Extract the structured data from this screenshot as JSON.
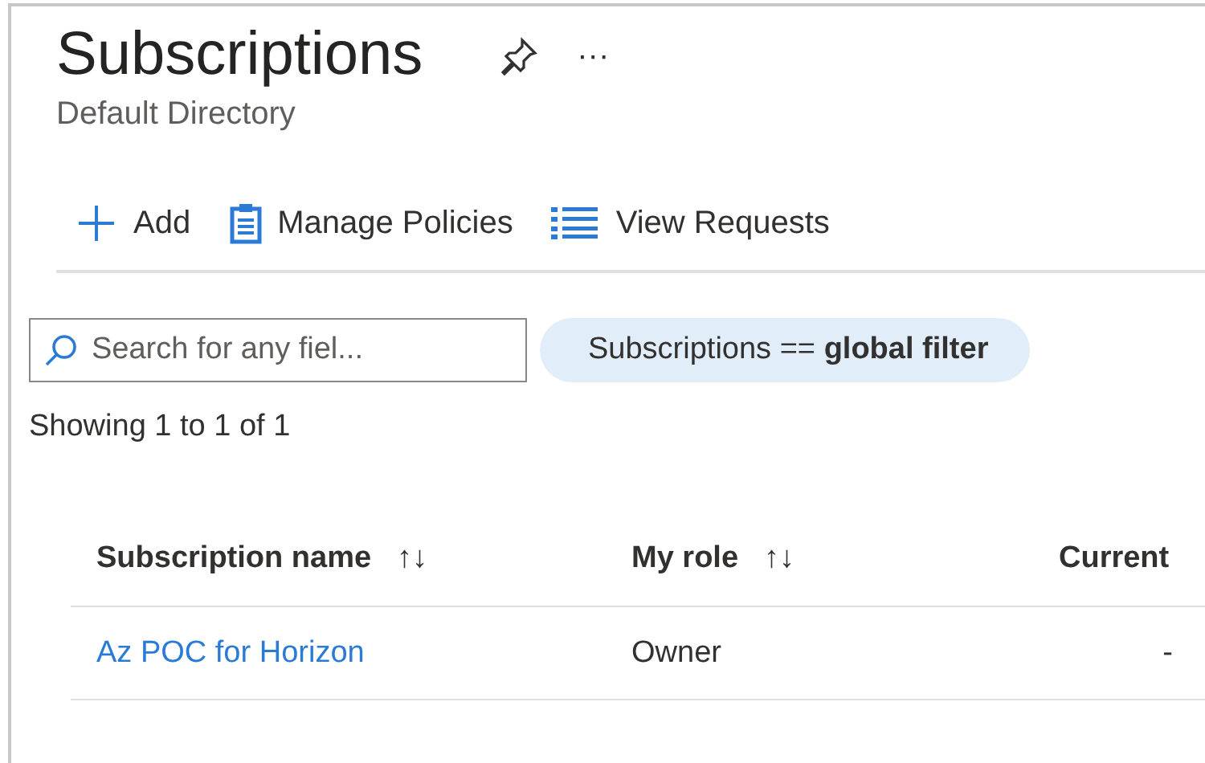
{
  "header": {
    "title": "Subscriptions",
    "more": "···",
    "subtitle": "Default Directory"
  },
  "toolbar": [
    {
      "kind": "add",
      "label": "Add"
    },
    {
      "kind": "policies",
      "label": "Manage Policies"
    },
    {
      "kind": "requests",
      "label": "View Requests"
    }
  ],
  "search": {
    "placeholder": "Search for any fiel..."
  },
  "filter_pill": "Subscriptions == **global filter**",
  "result_count": "Showing 1 to 1 of 1",
  "table": {
    "columns": [
      {
        "label": "Subscription name",
        "sort": "↑↓"
      },
      {
        "label": "My role",
        "sort": "↑↓"
      },
      {
        "label": "Current"
      }
    ],
    "rows": [
      {
        "cells": [
          "Az POC for Horizon",
          "Owner",
          "-"
        ]
      }
    ]
  }
}
